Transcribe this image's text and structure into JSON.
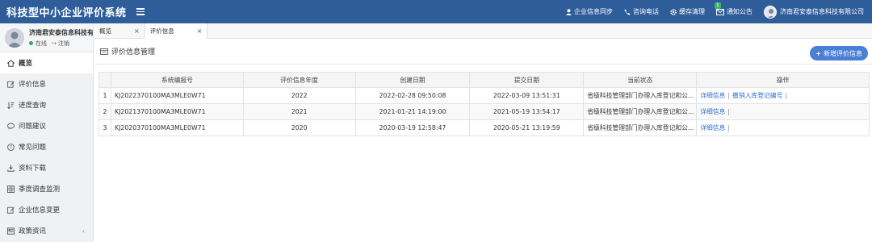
{
  "header": {
    "title": "科技型中小企业评价系统",
    "nav": [
      {
        "label": "企业信息同步",
        "icon": "user-icon"
      },
      {
        "label": "咨询电话",
        "icon": "phone-icon"
      },
      {
        "label": "缓存清理",
        "icon": "gear-icon"
      },
      {
        "label": "通知公告",
        "icon": "envelope-icon",
        "badge": "1"
      }
    ],
    "company": "济南君安泰信息科技有限公司"
  },
  "sidebar": {
    "user_name": "济南君安泰信息科技有",
    "status_online": "在线",
    "status_logout": "注销",
    "items": [
      {
        "label": "概览",
        "icon": "home-icon",
        "active": true
      },
      {
        "label": "评价信息",
        "icon": "edit-icon"
      },
      {
        "label": "进度查询",
        "icon": "sort-icon"
      },
      {
        "label": "问题建议",
        "icon": "comment-icon"
      },
      {
        "label": "常见问题",
        "icon": "question-icon"
      },
      {
        "label": "资料下载",
        "icon": "download-icon"
      },
      {
        "label": "季度调查监测",
        "icon": "grid-icon"
      },
      {
        "label": "企业信息变更",
        "icon": "edit-icon"
      },
      {
        "label": "政策资讯",
        "icon": "news-icon"
      }
    ]
  },
  "tabs": [
    {
      "label": "概览",
      "active": false
    },
    {
      "label": "评价信息",
      "active": true
    }
  ],
  "content": {
    "title": "评价信息管理",
    "add_button": "新增评价信息",
    "columns": [
      "系统编报号",
      "评价信息年度",
      "创建日期",
      "提交日期",
      "当前状态",
      "操作"
    ],
    "rows": [
      {
        "index": "1",
        "code": "KJ2022370100MA3MLE0W71",
        "year": "2022",
        "created": "2022-02-28 09:50:08",
        "submitted": "2022-03-09 13:51:31",
        "status": "省级科技管理部门办理入库登记和公...",
        "op1": "详细信息",
        "op2": "撤销入库登记编号"
      },
      {
        "index": "2",
        "code": "KJ2021370100MA3MLE0W71",
        "year": "2021",
        "created": "2021-01-21 14:19:00",
        "submitted": "2021-05-19 13:54:17",
        "status": "省级科技管理部门办理入库登记和公...",
        "op1": "详细信息",
        "op2": ""
      },
      {
        "index": "3",
        "code": "KJ2020370100MA3MLE0W71",
        "year": "2020",
        "created": "2020-03-19 12:58:47",
        "submitted": "2020-05-21 13:19:59",
        "status": "省级科技管理部门办理入库登记和公...",
        "op1": "详细信息",
        "op2": ""
      }
    ]
  }
}
